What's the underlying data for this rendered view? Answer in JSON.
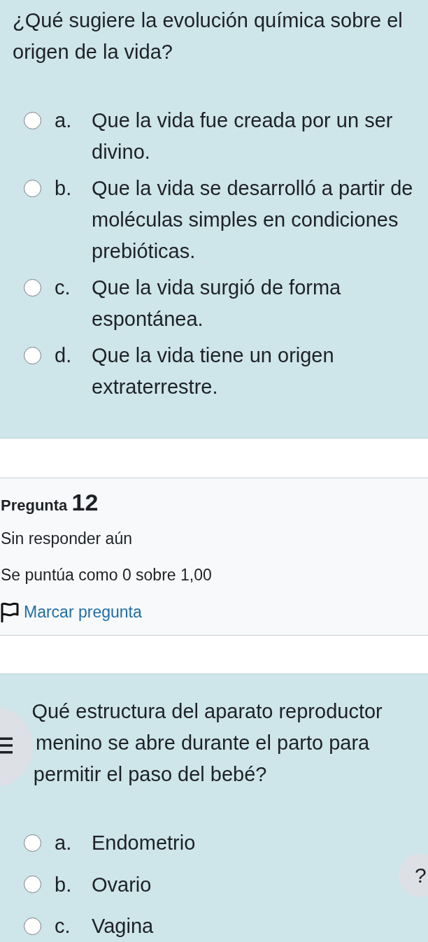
{
  "previous_question": {
    "text": "¿Qué sugiere la evolución química sobre el origen de la vida?",
    "options": [
      {
        "letter": "a.",
        "text": "Que la vida fue creada por un ser divino.",
        "selected": false
      },
      {
        "letter": "b.",
        "text": "Que la vida se desarrolló a partir de moléculas simples en condiciones prebióticas.",
        "selected": false
      },
      {
        "letter": "c.",
        "text": "Que la vida surgió de forma espontánea.",
        "selected": false
      },
      {
        "letter": "d.",
        "text": "Que la vida tiene un origen extraterrestre.",
        "selected": false
      }
    ]
  },
  "question": {
    "title": "Pregunta",
    "number": "12",
    "status": "Sin responder aún",
    "grade": "Se puntúa como 0 sobre 1,00",
    "flag": {
      "label": "Marcar pregunta",
      "flagged": false
    },
    "text": "Qué estructura del aparato reproductor menino se abre durante el parto para permitir el paso del bebé?",
    "options": [
      {
        "letter": "a.",
        "text": "Endometrio",
        "selected": false
      },
      {
        "letter": "b.",
        "text": "Ovario",
        "selected": false
      },
      {
        "letter": "c.",
        "text": "Vagina",
        "selected": false
      }
    ]
  },
  "help_button": {
    "label": "?"
  }
}
